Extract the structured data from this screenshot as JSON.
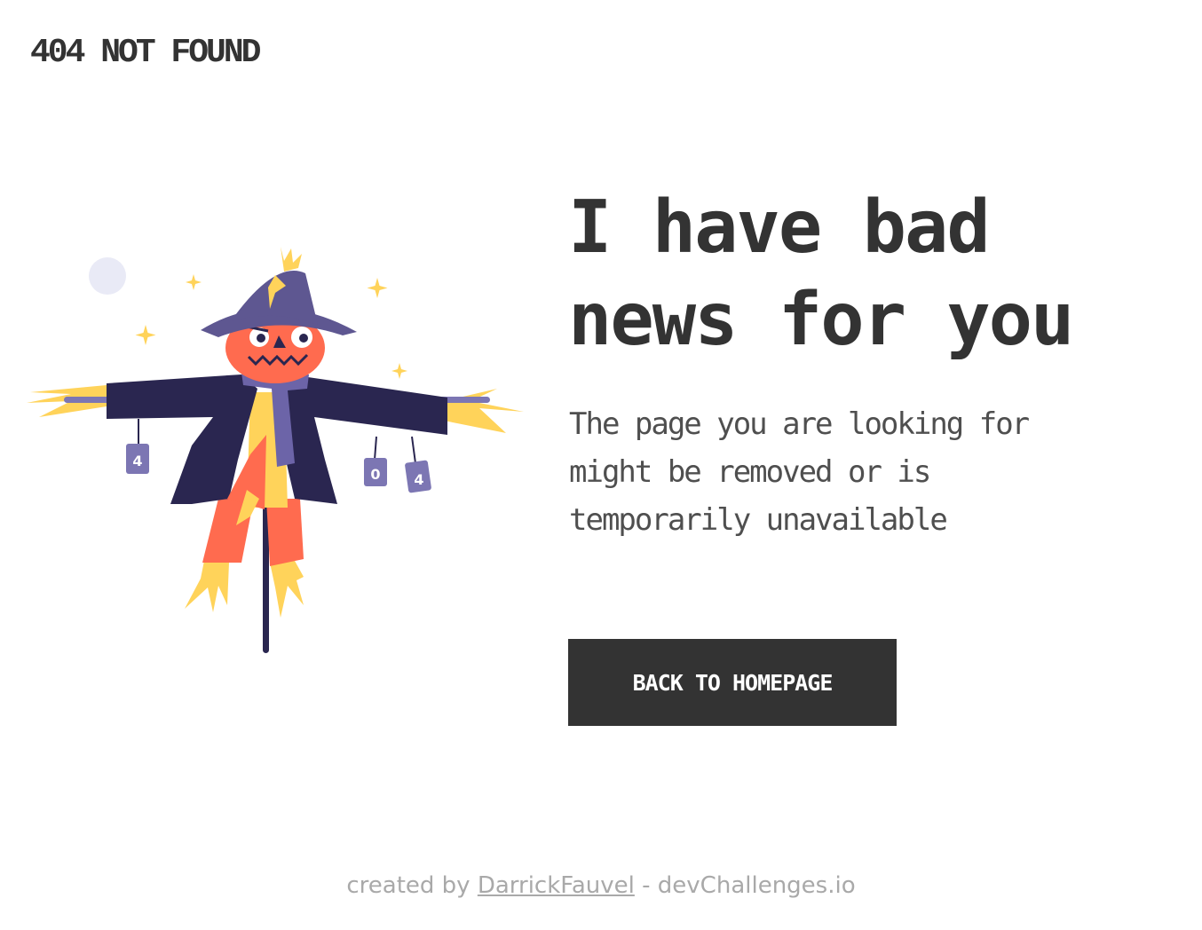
{
  "header": {
    "brand": "404 NOT FOUND"
  },
  "main": {
    "headline_line1": "I have bad",
    "headline_line2": "news for you",
    "message_line1": "The page you are looking for",
    "message_line2": "might be removed or is",
    "message_line3": "temporarily unavailable",
    "button_label": "BACK TO HOMEPAGE"
  },
  "illustration": {
    "name": "scarecrow-illustration",
    "can_labels": [
      "4",
      "0",
      "4"
    ]
  },
  "footer": {
    "prefix": "created by ",
    "author": "DarrickFauvel",
    "separator": " - ",
    "site": "devChallenges.io"
  },
  "colors": {
    "text": "#333333",
    "button_bg": "#333333",
    "button_text": "#ffffff",
    "footer_text": "#a9a9a9",
    "hat": "#5e5791",
    "coat": "#2a2650",
    "face": "#ff6b4f",
    "straw": "#ffd35a",
    "scarf": "#6c64a8",
    "moon": "#e9eaf6"
  }
}
